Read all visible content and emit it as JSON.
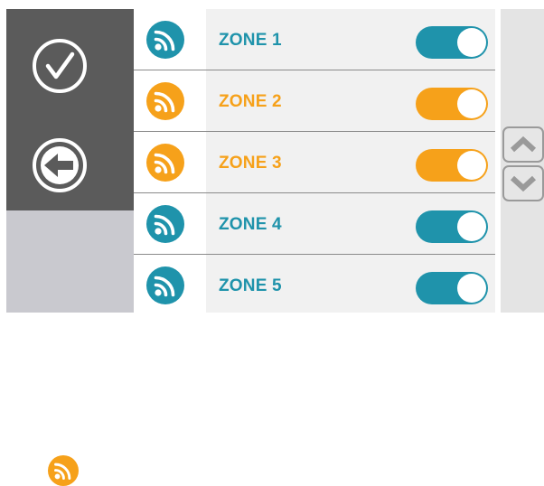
{
  "colors": {
    "teal": "#1f93ab",
    "orange": "#f6a11a",
    "dark_panel": "#5b5b5b",
    "light_panel": "#c9c9cf",
    "row_bg": "#f1f1f1",
    "divider": "#8a8a8a",
    "scroll_arrow": "#9a9a9a"
  },
  "sidebar": {
    "confirm_icon": "check-circle-icon",
    "back_icon": "arrow-left-circle-icon",
    "active_zone_icon": "signal-icon",
    "active_zone_color": "orange"
  },
  "zones": [
    {
      "label": "ZONE 1",
      "color": "teal",
      "enabled": true
    },
    {
      "label": "ZONE 2",
      "color": "orange",
      "enabled": true
    },
    {
      "label": "ZONE 3",
      "color": "orange",
      "enabled": true
    },
    {
      "label": "ZONE 4",
      "color": "teal",
      "enabled": true
    },
    {
      "label": "ZONE 5",
      "color": "teal",
      "enabled": true
    }
  ],
  "scroll": {
    "up_icon": "chevron-up-icon",
    "down_icon": "chevron-down-icon"
  }
}
